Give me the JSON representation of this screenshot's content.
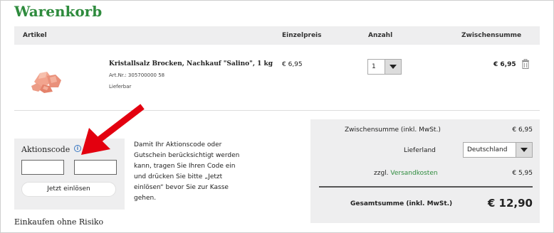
{
  "page": {
    "title": "Warenkorb"
  },
  "table": {
    "headers": {
      "article": "Artikel",
      "unit_price": "Einzelpreis",
      "quantity": "Anzahl",
      "subtotal": "Zwischensumme"
    },
    "items": [
      {
        "name": "Kristallsalz Brocken, Nachkauf \"Salino\", 1 kg",
        "sku": "Art.Nr.: 305700000 58",
        "availability": "Lieferbar",
        "price": "€ 6,95",
        "quantity": "1",
        "subtotal": "€ 6,95",
        "image_icon": "salt-crystals-image",
        "remove_icon": "trash-icon"
      }
    ]
  },
  "promo": {
    "label": "Aktionscode",
    "info_icon": "info-icon",
    "code_part1_value": "",
    "code_part2_value": "",
    "redeem_label": "Jetzt einlösen",
    "description": "Damit Ihr Aktionscode oder Gutschein berücksichtigt werden kann, tragen Sie Ihren Code ein und drücken Sie bitte „Jetzt einlösen“ bevor Sie zur Kasse gehen."
  },
  "summary": {
    "subtotal_label": "Zwischensumme (inkl. MwSt.)",
    "subtotal_value": "€ 6,95",
    "country_label": "Lieferland",
    "country_value": "Deutschland",
    "shipping_prefix": "zzgl.",
    "shipping_link": "Versandkosten",
    "shipping_value": "€ 5,95",
    "total_label": "Gesamtsumme (inkl. MwSt.)",
    "total_value": "€ 12,90"
  },
  "footer": {
    "heading": "Einkaufen ohne Risiko"
  },
  "colors": {
    "accent_green": "#2e8b3d",
    "panel_gray": "#eeeeef",
    "annotation_red": "#e3000f",
    "info_blue": "#3a78c2"
  }
}
